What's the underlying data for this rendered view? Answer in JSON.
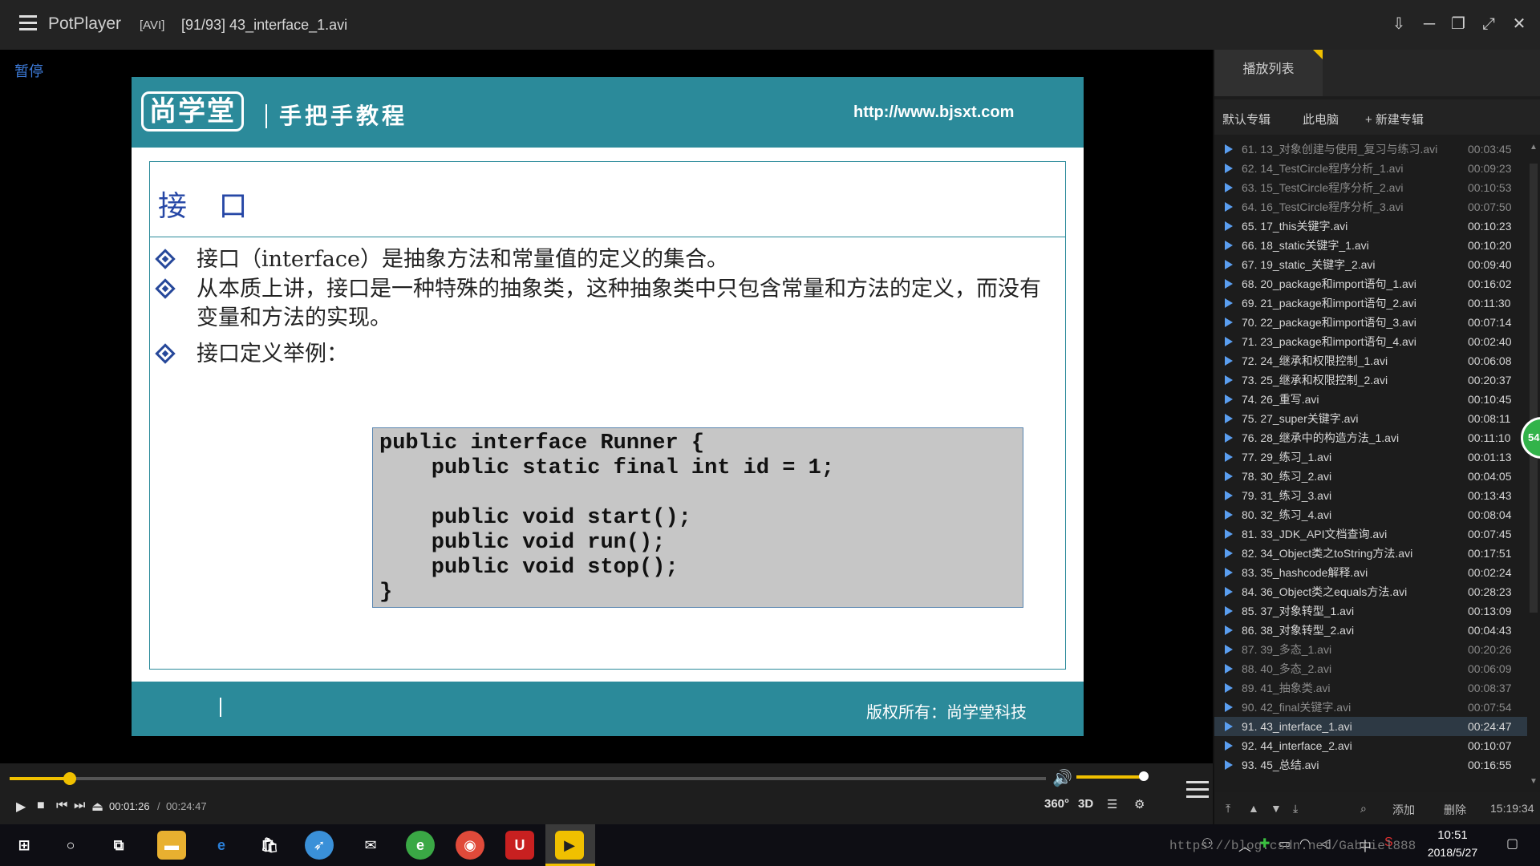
{
  "window": {
    "app_name": "PotPlayer",
    "format": "[AVI]",
    "file_title": "[91/93] 43_interface_1.avi"
  },
  "video": {
    "status": "暂停",
    "slide": {
      "logo_text": "尚学堂",
      "tagline": "手把手教程",
      "url": "http://www.bjsxt.com",
      "title": "接 口",
      "bullets": [
        "接口（interface）是抽象方法和常量值的定义的集合。",
        "从本质上讲，接口是一种特殊的抽象类，这种抽象类中只包含常量和方法的定义，而没有变量和方法的实现。",
        "接口定义举例："
      ],
      "code": "public interface Runner {\n    public static final int id = 1;\n\n    public void start();\n    public void run();\n    public void stop();\n}",
      "copyright": "版权所有：尚学堂科技"
    }
  },
  "playlist": {
    "tab_label": "播放列表",
    "albums": [
      "默认专辑",
      "此电脑",
      "+ 新建专辑"
    ],
    "items": [
      {
        "name": "61. 13_对象创建与使用_复习与练习.avi",
        "dur": "00:03:45",
        "state": "dim"
      },
      {
        "name": "62. 14_TestCircle程序分析_1.avi",
        "dur": "00:09:23",
        "state": "dim"
      },
      {
        "name": "63. 15_TestCircle程序分析_2.avi",
        "dur": "00:10:53",
        "state": "dim"
      },
      {
        "name": "64. 16_TestCircle程序分析_3.avi",
        "dur": "00:07:50",
        "state": "dim"
      },
      {
        "name": "65. 17_this关键字.avi",
        "dur": "00:10:23",
        "state": ""
      },
      {
        "name": "66. 18_static关键字_1.avi",
        "dur": "00:10:20",
        "state": ""
      },
      {
        "name": "67. 19_static_关键字_2.avi",
        "dur": "00:09:40",
        "state": ""
      },
      {
        "name": "68. 20_package和import语句_1.avi",
        "dur": "00:16:02",
        "state": ""
      },
      {
        "name": "69. 21_package和import语句_2.avi",
        "dur": "00:11:30",
        "state": ""
      },
      {
        "name": "70. 22_package和import语句_3.avi",
        "dur": "00:07:14",
        "state": ""
      },
      {
        "name": "71. 23_package和import语句_4.avi",
        "dur": "00:02:40",
        "state": ""
      },
      {
        "name": "72. 24_继承和权限控制_1.avi",
        "dur": "00:06:08",
        "state": ""
      },
      {
        "name": "73. 25_继承和权限控制_2.avi",
        "dur": "00:20:37",
        "state": ""
      },
      {
        "name": "74. 26_重写.avi",
        "dur": "00:10:45",
        "state": ""
      },
      {
        "name": "75. 27_super关键字.avi",
        "dur": "00:08:11",
        "state": ""
      },
      {
        "name": "76. 28_继承中的构造方法_1.avi",
        "dur": "00:11:10",
        "state": ""
      },
      {
        "name": "77. 29_练习_1.avi",
        "dur": "00:01:13",
        "state": ""
      },
      {
        "name": "78. 30_练习_2.avi",
        "dur": "00:04:05",
        "state": ""
      },
      {
        "name": "79. 31_练习_3.avi",
        "dur": "00:13:43",
        "state": ""
      },
      {
        "name": "80. 32_练习_4.avi",
        "dur": "00:08:04",
        "state": ""
      },
      {
        "name": "81. 33_JDK_API文档查询.avi",
        "dur": "00:07:45",
        "state": ""
      },
      {
        "name": "82. 34_Object类之toString方法.avi",
        "dur": "00:17:51",
        "state": ""
      },
      {
        "name": "83. 35_hashcode解释.avi",
        "dur": "00:02:24",
        "state": ""
      },
      {
        "name": "84. 36_Object类之equals方法.avi",
        "dur": "00:28:23",
        "state": ""
      },
      {
        "name": "85. 37_对象转型_1.avi",
        "dur": "00:13:09",
        "state": ""
      },
      {
        "name": "86. 38_对象转型_2.avi",
        "dur": "00:04:43",
        "state": ""
      },
      {
        "name": "87. 39_多态_1.avi",
        "dur": "00:20:26",
        "state": "dim"
      },
      {
        "name": "88. 40_多态_2.avi",
        "dur": "00:06:09",
        "state": "dim"
      },
      {
        "name": "89. 41_抽象类.avi",
        "dur": "00:08:37",
        "state": "dim"
      },
      {
        "name": "90. 42_final关键字.avi",
        "dur": "00:07:54",
        "state": "dim"
      },
      {
        "name": "91. 43_interface_1.avi",
        "dur": "00:24:47",
        "state": "active"
      },
      {
        "name": "92. 44_interface_2.avi",
        "dur": "00:10:07",
        "state": ""
      },
      {
        "name": "93. 45_总结.avi",
        "dur": "00:16:55",
        "state": ""
      }
    ],
    "bottom": {
      "add": "添加",
      "delete": "删除",
      "total": "15:19:34"
    },
    "side_badge": "54"
  },
  "controls": {
    "time_current": "00:01:26",
    "time_sep": "/",
    "time_total": "00:24:47",
    "progress_fraction": 0.058,
    "btn_360": "360°",
    "btn_3d": "3D"
  },
  "taskbar": {
    "time": "10:51",
    "date": "2018/5/27",
    "ime": "中",
    "watermark": "https://blog.csdn.net/Gabriel888"
  },
  "colors": {
    "accent": "#f0c000",
    "slide_teal": "#2b8a9a",
    "pause_blue": "#3d7bd9"
  }
}
